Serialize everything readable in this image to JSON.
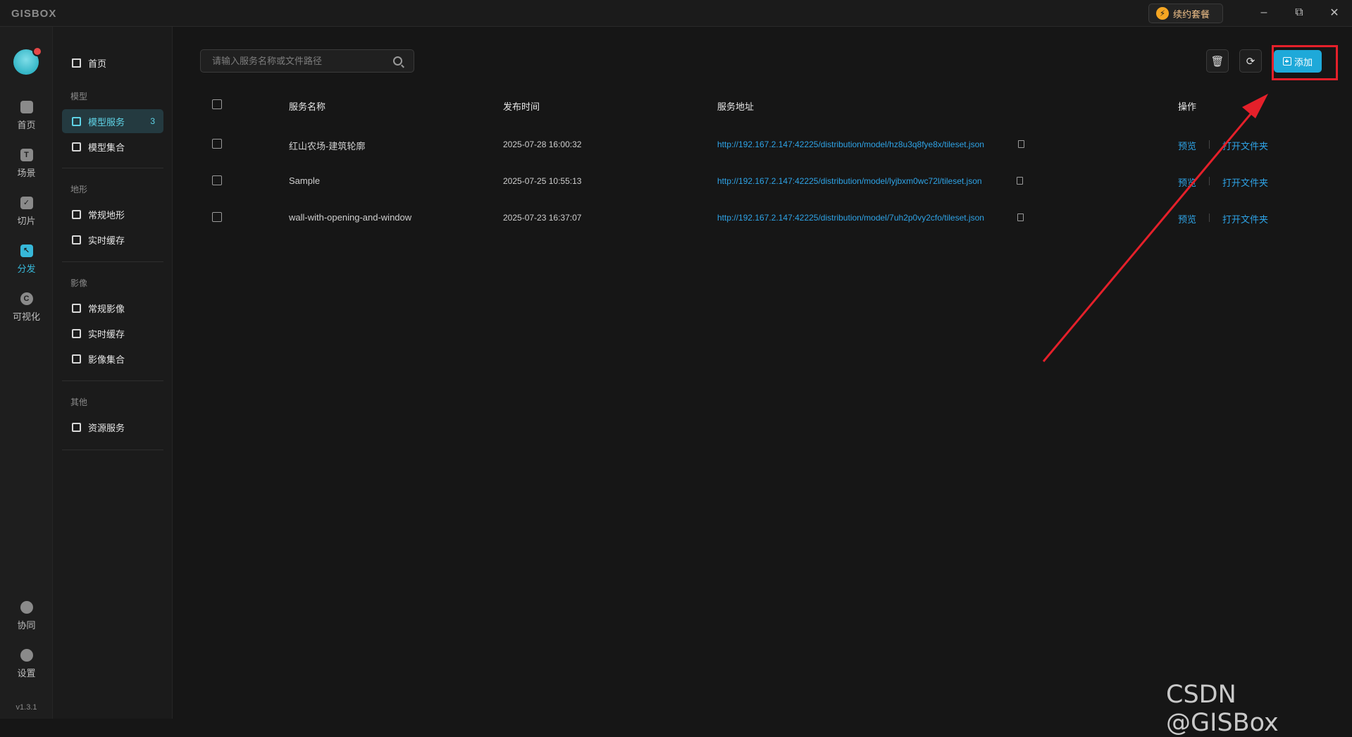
{
  "app": {
    "logo": "GISBOX",
    "renew_label": "续约套餐"
  },
  "window_controls": {
    "minimize": "–",
    "restore": "⧉",
    "close": "✕"
  },
  "rail": {
    "items": [
      {
        "label": "首页",
        "icon": "home-icon"
      },
      {
        "label": "场景",
        "icon": "scene-icon"
      },
      {
        "label": "切片",
        "icon": "tile-icon"
      },
      {
        "label": "分发",
        "icon": "distribute-icon",
        "active": true
      },
      {
        "label": "可视化",
        "icon": "visualize-icon"
      }
    ],
    "bottom": [
      {
        "label": "协同",
        "icon": "collab-icon"
      },
      {
        "label": "设置",
        "icon": "settings-icon"
      }
    ],
    "version": "v1.3.1"
  },
  "sidenav": {
    "home": "首页",
    "groups": [
      {
        "title": "模型",
        "items": [
          {
            "label": "模型服务",
            "count": "3",
            "active": true
          },
          {
            "label": "模型集合"
          }
        ]
      },
      {
        "title": "地形",
        "items": [
          {
            "label": "常规地形"
          },
          {
            "label": "实时缓存"
          }
        ]
      },
      {
        "title": "影像",
        "items": [
          {
            "label": "常规影像"
          },
          {
            "label": "实时缓存"
          },
          {
            "label": "影像集合"
          }
        ]
      },
      {
        "title": "其他",
        "items": [
          {
            "label": "资源服务"
          }
        ]
      }
    ]
  },
  "search": {
    "placeholder": "请输入服务名称或文件路径"
  },
  "toolbar": {
    "add_label": "添加"
  },
  "table": {
    "headers": [
      "服务名称",
      "发布时间",
      "服务地址",
      "操作"
    ],
    "rows": [
      {
        "name": "红山农场-建筑轮廓",
        "time": "2025-07-28 16:00:32",
        "url": "http://192.167.2.147:42225/distribution/model/hz8u3q8fye8x/tileset.json"
      },
      {
        "name": "Sample",
        "time": "2025-07-25 10:55:13",
        "url": "http://192.167.2.147:42225/distribution/model/lyjbxm0wc72l/tileset.json"
      },
      {
        "name": "wall-with-opening-and-window",
        "time": "2025-07-23 16:37:07",
        "url": "http://192.167.2.147:42225/distribution/model/7uh2p0vy2cfo/tileset.json"
      }
    ],
    "actions": {
      "preview": "预览",
      "open_folder": "打开文件夹"
    }
  },
  "colors": {
    "accent": "#1ea9d9",
    "link": "#2ea3e6",
    "annotation": "#e5202a"
  },
  "watermark": "CSDN @GISBox"
}
